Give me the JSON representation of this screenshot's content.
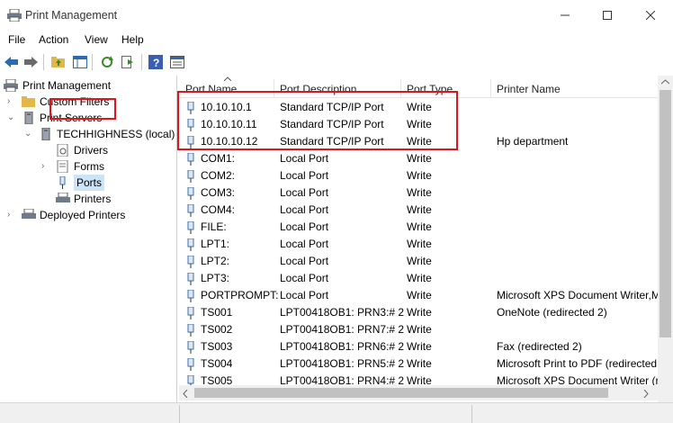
{
  "window": {
    "title": "Print Management"
  },
  "menu": [
    "File",
    "Action",
    "View",
    "Help"
  ],
  "tree": {
    "root": "Print Management",
    "custom_filters": "Custom Filters",
    "print_servers": "Print Servers",
    "server": "TECHHIGHNESS (local)",
    "drivers": "Drivers",
    "forms": "Forms",
    "ports": "Ports",
    "printers": "Printers",
    "deployed_printers": "Deployed Printers"
  },
  "list": {
    "columns": [
      "Port Name",
      "Port Description",
      "Port Type",
      "Printer Name"
    ],
    "rows": [
      {
        "name": "10.10.10.1",
        "desc": "Standard TCP/IP Port",
        "type": "Write",
        "printer": ""
      },
      {
        "name": "10.10.10.11",
        "desc": "Standard TCP/IP Port",
        "type": "Write",
        "printer": ""
      },
      {
        "name": "10.10.10.12",
        "desc": "Standard TCP/IP Port",
        "type": "Write",
        "printer": "Hp department"
      },
      {
        "name": "COM1:",
        "desc": "Local Port",
        "type": "Write",
        "printer": ""
      },
      {
        "name": "COM2:",
        "desc": "Local Port",
        "type": "Write",
        "printer": ""
      },
      {
        "name": "COM3:",
        "desc": "Local Port",
        "type": "Write",
        "printer": ""
      },
      {
        "name": "COM4:",
        "desc": "Local Port",
        "type": "Write",
        "printer": ""
      },
      {
        "name": "FILE:",
        "desc": "Local Port",
        "type": "Write",
        "printer": ""
      },
      {
        "name": "LPT1:",
        "desc": "Local Port",
        "type": "Write",
        "printer": ""
      },
      {
        "name": "LPT2:",
        "desc": "Local Port",
        "type": "Write",
        "printer": ""
      },
      {
        "name": "LPT3:",
        "desc": "Local Port",
        "type": "Write",
        "printer": ""
      },
      {
        "name": "PORTPROMPT:",
        "desc": "Local Port",
        "type": "Write",
        "printer": "Microsoft XPS Document Writer,M"
      },
      {
        "name": "TS001",
        "desc": "LPT00418OB1:  PRN3:# 2",
        "type": "Write",
        "printer": "OneNote (redirected 2)"
      },
      {
        "name": "TS002",
        "desc": "LPT00418OB1:  PRN7:# 2",
        "type": "Write",
        "printer": ""
      },
      {
        "name": "TS003",
        "desc": "LPT00418OB1:  PRN6:# 2",
        "type": "Write",
        "printer": "Fax (redirected 2)"
      },
      {
        "name": "TS004",
        "desc": "LPT00418OB1:  PRN5:# 2",
        "type": "Write",
        "printer": "Microsoft Print to PDF (redirected"
      },
      {
        "name": "TS005",
        "desc": "LPT00418OB1:  PRN4:# 2",
        "type": "Write",
        "printer": "Microsoft XPS Document Writer (r"
      }
    ]
  },
  "colors": {
    "highlight_box": "#e0141c",
    "accent": "#2b6cb0"
  }
}
